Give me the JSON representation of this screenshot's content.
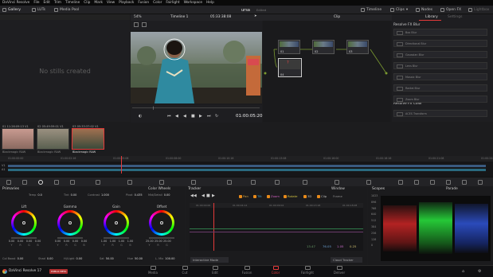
{
  "menubar": {
    "items": [
      "DaVinci Resolve",
      "File",
      "Edit",
      "Trim",
      "Timeline",
      "Clip",
      "Mark",
      "View",
      "Playback",
      "Fusion",
      "Color",
      "Fairlight",
      "Workspace",
      "Help"
    ]
  },
  "topbar": {
    "gallery": "Gallery",
    "luts": "LUTs",
    "media_pool": "Media Pool",
    "project_name": "ursa",
    "edited": "Edited",
    "timeline": "Timeline",
    "clips": "Clips",
    "nodes": "Nodes",
    "open_fx": "Open FX",
    "lightbox": "Lightbox"
  },
  "viewer": {
    "zoom": "54%",
    "timeline_name": "Timeline 1",
    "timecode_top": "05:33:38:08",
    "clip_mode": "Clip",
    "timecode": "01:00:05:20"
  },
  "gallery": {
    "empty_text": "No stills created"
  },
  "nodes": {
    "labels": [
      "01",
      "02",
      "03",
      "04"
    ]
  },
  "library": {
    "tab_library": "Library",
    "tab_settings": "Settings",
    "blur_section": "Resolve FX Blur",
    "blur_items": [
      "Box Blur",
      "Directional Blur",
      "Gaussian Blur",
      "Lens Blur",
      "Mosaic Blur",
      "Radial Blur",
      "Zoom Blur"
    ],
    "color_section": "Resolve FX Color",
    "color_items": [
      "ACES Transform"
    ]
  },
  "clips": [
    {
      "num": "01",
      "tc": "11:26:09:13",
      "track": "V1",
      "name": "Blackmagic RAW"
    },
    {
      "num": "02",
      "tc": "05:49:59:01",
      "track": "V1",
      "name": "Blackmagic RAW"
    },
    {
      "num": "03",
      "tc": "05:33:37:02",
      "track": "V1",
      "name": "Blackmagic RAW"
    }
  ],
  "timeline_ruler": [
    "01:00:00:00",
    "01:00:02:16",
    "01:00:05:08",
    "01:00:08:00",
    "01:00:10:16",
    "01:00:13:08",
    "01:00:16:00",
    "01:00:18:16",
    "01:00:21:08",
    "01:00:24:00"
  ],
  "tracks": [
    "V1",
    "A1"
  ],
  "primaries": {
    "title": "Primaries",
    "mode": "Color Wheels",
    "temp_label": "Temp",
    "temp": "0.0",
    "tint_label": "Tint",
    "tint": "0.00",
    "contrast_label": "Contrast",
    "contrast": "1.000",
    "pivot_label": "Pivot",
    "pivot": "0.435",
    "mid_label": "Mid/Detail",
    "mid": "0.00",
    "wheels": [
      {
        "name": "Lift",
        "vals": [
          "0.00",
          "0.00",
          "0.00",
          "0.00"
        ]
      },
      {
        "name": "Gamma",
        "vals": [
          "0.00",
          "0.00",
          "0.00",
          "0.00"
        ]
      },
      {
        "name": "Gain",
        "vals": [
          "1.00",
          "1.00",
          "1.00",
          "1.00"
        ]
      },
      {
        "name": "Offset",
        "vals": [
          "25.00",
          "25.00",
          "25.00"
        ]
      }
    ],
    "wheel_channels": [
      "Y",
      "R",
      "G",
      "B"
    ],
    "col_boost_label": "Col Boost",
    "col_boost": "0.00",
    "shad_label": "Shad",
    "shad": "0.00",
    "hilight_label": "Hi/Light",
    "hilight": "0.00",
    "sat_label": "Sat",
    "sat": "50.00",
    "hue_label": "Hue",
    "hue": "50.00",
    "lmix_label": "L. Mix",
    "lmix": "100.00"
  },
  "tracker": {
    "title": "Tracker",
    "window": "Window",
    "pan": "Pan",
    "tilt": "Tilt",
    "zoom": "Zoom",
    "rotate": "Rotate",
    "threed": "3D",
    "clip": "Clip",
    "frame": "Frame",
    "ruler": [
      "01:00:00:00",
      "01:00:04:14",
      "01:00:09:04",
      "01:00:13:18",
      "01:00:18:08"
    ],
    "values": [
      "13.47",
      "76.05",
      "1.05",
      "0.25"
    ],
    "interactive_mode": "Interactive Mode",
    "cloud_tracker": "Cloud Tracker"
  },
  "scopes": {
    "title": "Scopes",
    "mode": "Parade",
    "scale": [
      "1023",
      "896",
      "768",
      "640",
      "512",
      "384",
      "256",
      "128",
      "0"
    ]
  },
  "bottom": {
    "app": "DaVinci Resolve 17",
    "badge": "PUBLIC BETA",
    "pages": [
      "Media",
      "Cut",
      "Edit",
      "Fusion",
      "Color",
      "Fairlight",
      "Deliver"
    ]
  },
  "colors": {
    "accent_red": "#e43a3a",
    "playhead": "#e43a3a",
    "orange_check": "#e88a1a"
  }
}
